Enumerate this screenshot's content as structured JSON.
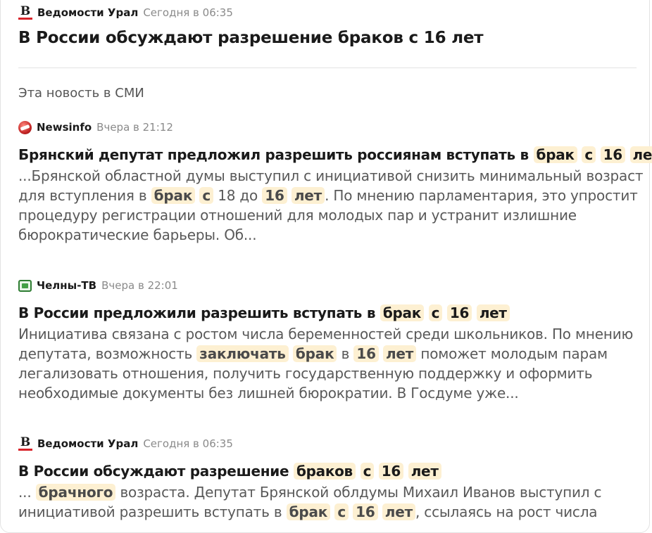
{
  "header": {
    "source": "Ведомости Урал",
    "time": "Сегодня в 06:35",
    "title": "В России обсуждают разрешение браков с 16 лет"
  },
  "section_label": "Эта новость в СМИ",
  "articles": [
    {
      "icon": "newsinfo-logo-icon",
      "source": "Newsinfo",
      "time": "Вчера в 21:12",
      "title": [
        {
          "t": "Брянский депутат предложил разрешить россиянам вступать в "
        },
        {
          "t": "брак",
          "h": true
        },
        {
          "t": " "
        },
        {
          "t": "с",
          "h": true
        },
        {
          "t": " "
        },
        {
          "t": "16",
          "h": true
        },
        {
          "t": " "
        },
        {
          "t": "лет",
          "h": true
        }
      ],
      "snippet_lines": [
        [
          {
            "t": "...Брянской областной думы выступил с инициативой снизить минимальный возраст"
          }
        ],
        [
          {
            "t": "для вступления в "
          },
          {
            "t": "брак",
            "h": true
          },
          {
            "t": " "
          },
          {
            "t": "с",
            "h": true
          },
          {
            "t": " 18 до "
          },
          {
            "t": "16",
            "h": true
          },
          {
            "t": " "
          },
          {
            "t": "лет",
            "h": true
          },
          {
            "t": ". По мнению парламентария, это упростит"
          }
        ],
        [
          {
            "t": "процедуру регистрации отношений для молодых пар и устранит излишние"
          }
        ],
        [
          {
            "t": "бюрократические барьеры. Об..."
          }
        ]
      ]
    },
    {
      "icon": "chelny-tv-logo-icon",
      "source": "Челны-ТВ",
      "time": "Вчера в 22:01",
      "title": [
        {
          "t": "В России предложили разрешить вступать в "
        },
        {
          "t": "брак",
          "h": true
        },
        {
          "t": " "
        },
        {
          "t": "с",
          "h": true
        },
        {
          "t": " "
        },
        {
          "t": "16",
          "h": true
        },
        {
          "t": " "
        },
        {
          "t": "лет",
          "h": true
        }
      ],
      "snippet_lines": [
        [
          {
            "t": "Инициатива связана с ростом числа беременностей среди школьников. По мнению"
          }
        ],
        [
          {
            "t": "депутата, возможность "
          },
          {
            "t": "заключать",
            "h": true
          },
          {
            "t": " "
          },
          {
            "t": "брак",
            "h": true
          },
          {
            "t": " в "
          },
          {
            "t": "16",
            "h": true
          },
          {
            "t": " "
          },
          {
            "t": "лет",
            "h": true
          },
          {
            "t": " поможет молодым парам"
          }
        ],
        [
          {
            "t": "легализовать отношения, получить государственную поддержку и оформить"
          }
        ],
        [
          {
            "t": "необходимые документы без лишней бюрократии. В Госдуме уже..."
          }
        ]
      ]
    },
    {
      "icon": "vedomosti-logo-icon",
      "source": "Ведомости Урал",
      "time": "Сегодня в 06:35",
      "title": [
        {
          "t": "В России обсуждают разрешение "
        },
        {
          "t": "браков",
          "h": true
        },
        {
          "t": " "
        },
        {
          "t": "с",
          "h": true
        },
        {
          "t": " "
        },
        {
          "t": "16",
          "h": true
        },
        {
          "t": " "
        },
        {
          "t": "лет",
          "h": true
        }
      ],
      "snippet_lines": [
        [
          {
            "t": "... "
          },
          {
            "t": "брачного",
            "h": true
          },
          {
            "t": " возраста. Депутат Брянской облдумы Михаил Иванов выступил с"
          }
        ],
        [
          {
            "t": "инициативой разрешить вступать в "
          },
          {
            "t": "брак",
            "h": true
          },
          {
            "t": " "
          },
          {
            "t": "с",
            "h": true
          },
          {
            "t": " "
          },
          {
            "t": "16",
            "h": true
          },
          {
            "t": " "
          },
          {
            "t": "лет",
            "h": true
          },
          {
            "t": ", ссылаясь на рост числа"
          }
        ]
      ]
    }
  ]
}
